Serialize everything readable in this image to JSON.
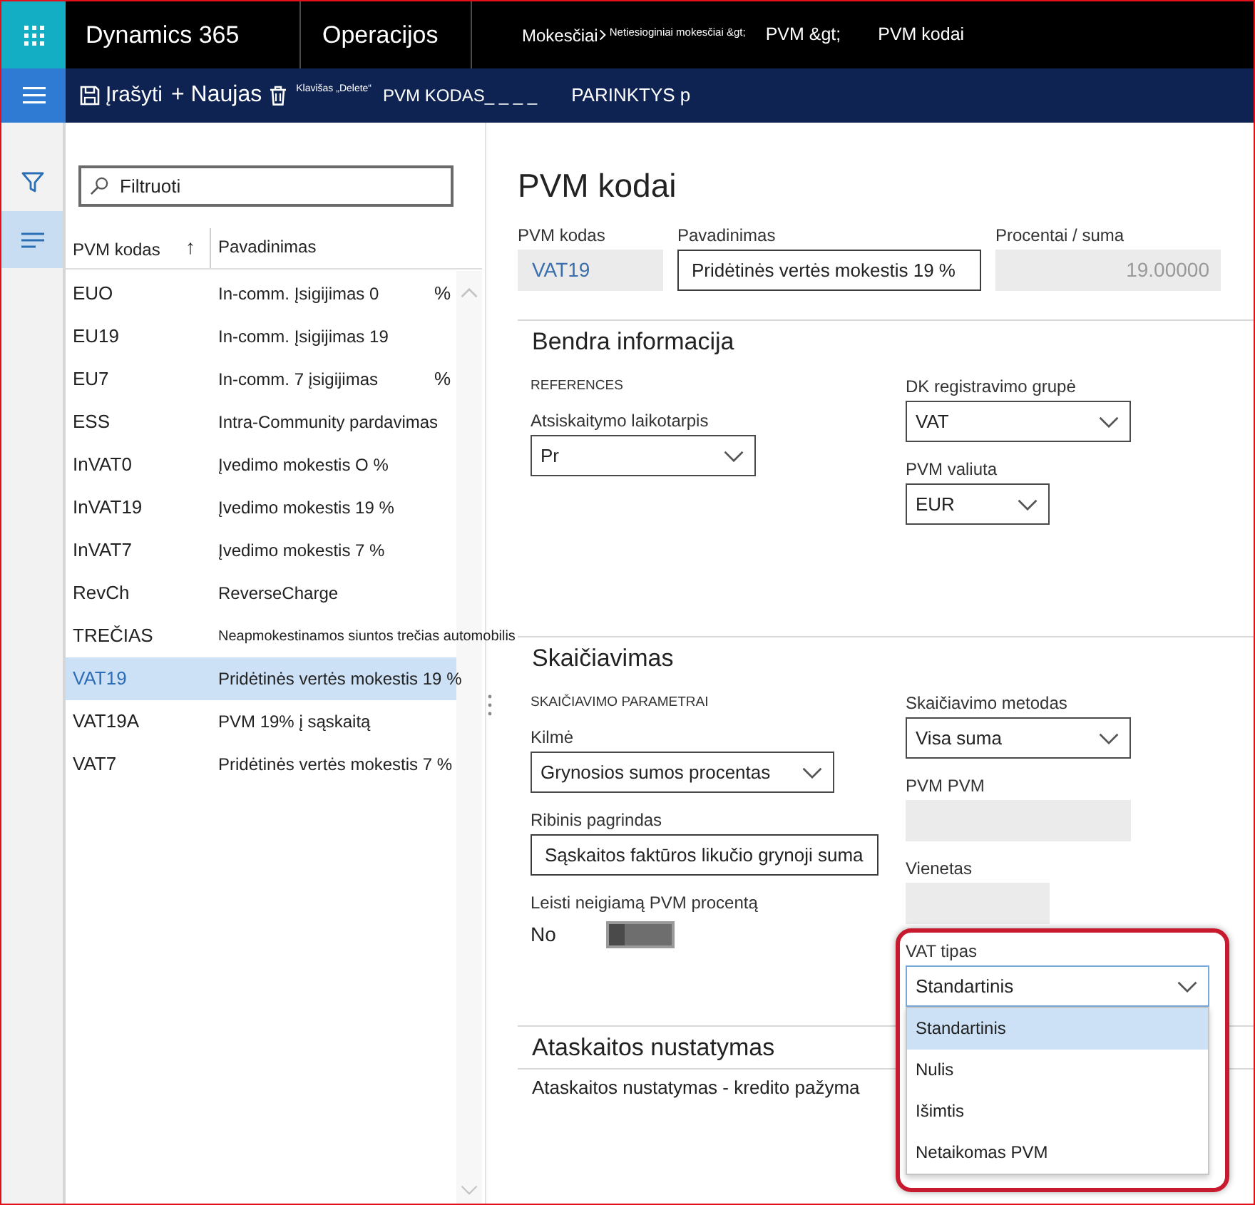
{
  "top_bar": {
    "app_name": "Dynamics 365",
    "module": "Operacijos",
    "breadcrumb": [
      {
        "kind": "root",
        "text": "Mokesčiai"
      },
      {
        "kind": "note",
        "text": "Netiesioginiai mokesčiai &gt;"
      },
      {
        "kind": "link",
        "text": "PVM &gt;"
      },
      {
        "kind": "link",
        "text": "PVM kodai"
      }
    ]
  },
  "action_bar": {
    "items": [
      {
        "kind": "save",
        "label": "Įrašyti"
      },
      {
        "kind": "new",
        "label": "+ Naujas"
      },
      {
        "kind": "delete",
        "hint": "Klavišas „Delete“"
      },
      {
        "kind": "tab",
        "label": "PVM KODAS_ _ _ _"
      },
      {
        "kind": "tab",
        "label": "PARINKTYS p"
      }
    ]
  },
  "side_rail": {
    "items": [
      {
        "kind": "filter",
        "selected": false
      },
      {
        "kind": "list",
        "selected": true
      }
    ]
  },
  "list": {
    "filter": {
      "placeholder": "Filtruoti"
    },
    "columns": [
      {
        "label": "PVM kodas",
        "sort": "↑"
      },
      {
        "label": "Pavadinimas"
      }
    ],
    "rows": [
      {
        "code": "EUO",
        "name": "In-comm. Įsigijimas 0",
        "suffix": "%",
        "selected": false
      },
      {
        "code": "EU19",
        "name": "In-comm. Įsigijimas 19",
        "selected": false
      },
      {
        "code": "EU7",
        "name": "In-comm. 7 įsigijimas",
        "suffix": "%",
        "selected": false
      },
      {
        "code": "ESS",
        "name": "Intra-Community pardavimas",
        "selected": false
      },
      {
        "code": "InVAT0",
        "name": "Įvedimo mokestis O %",
        "selected": false
      },
      {
        "code": "InVAT19",
        "name": "Įvedimo mokestis 19 %",
        "selected": false
      },
      {
        "code": "InVAT7",
        "name": "Įvedimo mokestis 7 %",
        "selected": false
      },
      {
        "code": "RevCh",
        "name": "ReverseCharge",
        "selected": false
      },
      {
        "code": "TREČIAS",
        "name": "Neapmokestinamos siuntos trečias automobilis",
        "selected": false
      },
      {
        "code": "VAT19",
        "name": "Pridėtinės vertės mokestis 19 %",
        "selected": true
      },
      {
        "code": "VAT19A",
        "name": "PVM 19% į sąskaitą",
        "selected": false
      },
      {
        "code": "VAT7",
        "name": "Pridėtinės vertės mokestis 7 %",
        "selected": false
      }
    ]
  },
  "form": {
    "title": "PVM kodai",
    "header_fields": [
      {
        "kind": "key",
        "label": "PVM kodas",
        "value": "VAT19"
      },
      {
        "kind": "input",
        "label": "Pavadinimas",
        "value": "Pridėtinės vertės mokestis 19 %"
      },
      {
        "kind": "number",
        "label": "Procentai / suma",
        "value": "19.00000"
      }
    ],
    "sections": [
      {
        "kind": "fasttab",
        "title": "Bendra informacija",
        "columns": [
          {
            "fields": [
              {
                "kind": "caption",
                "text": "REFERENCES"
              },
              {
                "kind": "select",
                "label": "Atsiskaitymo laikotarpis",
                "value": "Pr",
                "expanded": false
              }
            ]
          },
          {
            "fields": [
              {
                "kind": "select",
                "label": "DK registravimo grupė",
                "value": "VAT",
                "expanded": false
              },
              {
                "kind": "select",
                "label": "PVM valiuta",
                "value": "EUR",
                "expanded": false
              }
            ]
          }
        ]
      },
      {
        "kind": "fasttab",
        "title": "Skaičiavimas",
        "columns": [
          {
            "fields": [
              {
                "kind": "caption",
                "text": "SKAIČIAVIMO PARAMETRAI"
              },
              {
                "kind": "select",
                "label": "Kilmė",
                "value": "Grynosios sumos procentas",
                "expanded": false
              },
              {
                "kind": "input",
                "label": "Ribinis pagrindas",
                "value": "Sąskaitos faktūros likučio grynoji suma"
              },
              {
                "kind": "toggle",
                "label": "Leisti neigiamą PVM procentą",
                "state_text": "No",
                "on": false
              }
            ]
          },
          {
            "fields": [
              {
                "kind": "select",
                "label": "Skaičiavimo metodas",
                "value": "Visa suma",
                "expanded": false
              },
              {
                "kind": "readonly",
                "label": "PVM PVM"
              },
              {
                "kind": "readonly",
                "label": "Vienetas"
              },
              {
                "kind": "select",
                "label": "VAT tipas",
                "value": "Standartinis",
                "expanded": true,
                "highlighted": true,
                "options": [
                  {
                    "text": "Standartinis",
                    "selected": true
                  },
                  {
                    "text": "Nulis",
                    "selected": false
                  },
                  {
                    "text": "Išimtis",
                    "selected": false
                  },
                  {
                    "text": "Netaikomas PVM",
                    "selected": false
                  }
                ]
              }
            ]
          }
        ]
      },
      {
        "kind": "fasttab",
        "title": "Ataskaitos nustatymas"
      },
      {
        "kind": "row",
        "title": "Ataskaitos nustatymas - kredito pažyma"
      }
    ]
  }
}
